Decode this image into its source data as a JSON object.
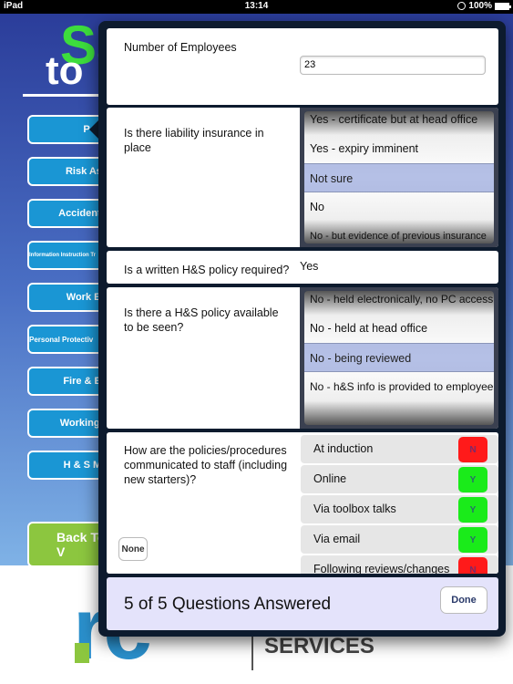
{
  "statusbar": {
    "device": "iPad",
    "time": "13:14",
    "battery": "100%"
  },
  "background": {
    "logo_letters": "Sa",
    "logo_to": "to",
    "nav": [
      {
        "label": "Policies",
        "visible": "P"
      },
      {
        "label": "Risk Assessments",
        "visible": "Risk Ass"
      },
      {
        "label": "Accidents and Incidents",
        "visible": "Accidents a"
      },
      {
        "label": "Information Instruction Training",
        "visible": "Information Instruction Tr"
      },
      {
        "label": "Work Equipment",
        "visible": "Work Eq"
      },
      {
        "label": "Personal Protective Equipment",
        "visible": "Personal Protectiv"
      },
      {
        "label": "Fire & Emergency",
        "visible": "Fire & Em"
      },
      {
        "label": "Working Environment",
        "visible": "Working Er"
      },
      {
        "label": "H & S Management",
        "visible": "H & S Mai"
      }
    ],
    "back_button": "Back To V",
    "footer_brand": "rc",
    "footer_services": "SERVICES"
  },
  "questions": {
    "employees": {
      "label": "Number of Employees",
      "value": "23"
    },
    "insurance": {
      "label": "Is there liability insurance in place",
      "options": [
        "Yes - certificate but at head office",
        "Yes - expiry imminent",
        "Not sure",
        "No",
        "No - but evidence of previous insurance"
      ],
      "selected": "Not sure"
    },
    "policy_required": {
      "label": "Is a written H&S policy required?",
      "answer": "Yes"
    },
    "policy_available": {
      "label": "Is there a H&S policy available to be seen?",
      "options": [
        "No - held electronically, no PC access",
        "No - held at head office",
        "No - being reviewed",
        "No - h&S info is provided to employees"
      ],
      "selected": "No - being reviewed"
    },
    "communication": {
      "label": "How are the policies/procedures communicated to staff (including new starters)?",
      "none_button": "None",
      "items": [
        {
          "label": "At induction",
          "value": "N",
          "color": "#ff1a1a"
        },
        {
          "label": "Online",
          "value": "Y",
          "color": "#1aeb1a"
        },
        {
          "label": "Via toolbox talks",
          "value": "Y",
          "color": "#1aeb1a"
        },
        {
          "label": "Via email",
          "value": "Y",
          "color": "#1aeb1a"
        },
        {
          "label": "Following reviews/changes",
          "value": "N",
          "color": "#ff1a1a"
        }
      ]
    }
  },
  "summary": {
    "text": "5 of 5 Questions Answered",
    "done_label": "Done"
  }
}
